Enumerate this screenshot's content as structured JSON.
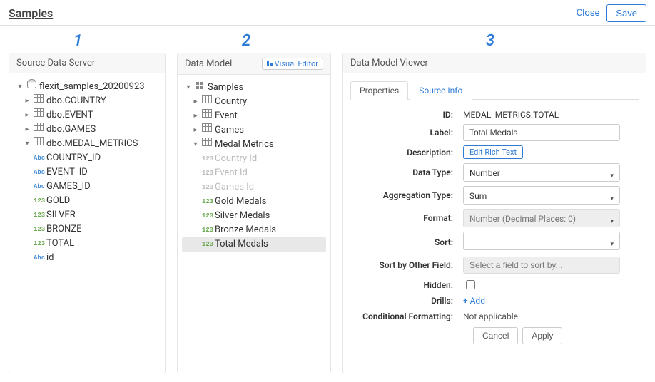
{
  "header": {
    "title": "Samples",
    "close": "Close",
    "save": "Save"
  },
  "badges": {
    "p1": "1",
    "p2": "2",
    "p3": "3"
  },
  "panel1": {
    "title": "Source Data Server",
    "root": "flexit_samples_20200923",
    "tables": [
      {
        "name": "dbo.COUNTRY",
        "expanded": false
      },
      {
        "name": "dbo.EVENT",
        "expanded": false
      },
      {
        "name": "dbo.GAMES",
        "expanded": false
      },
      {
        "name": "dbo.MEDAL_METRICS",
        "expanded": true,
        "columns": [
          {
            "name": "COUNTRY_ID",
            "type": "abc"
          },
          {
            "name": "EVENT_ID",
            "type": "abc"
          },
          {
            "name": "GAMES_ID",
            "type": "abc"
          },
          {
            "name": "GOLD",
            "type": "123"
          },
          {
            "name": "SILVER",
            "type": "123"
          },
          {
            "name": "BRONZE",
            "type": "123"
          },
          {
            "name": "TOTAL",
            "type": "123"
          },
          {
            "name": "id",
            "type": "abc"
          }
        ]
      }
    ]
  },
  "panel2": {
    "title": "Data Model",
    "visual_editor": "Visual Editor",
    "root": "Samples",
    "entities": [
      {
        "name": "Country",
        "expanded": false
      },
      {
        "name": "Event",
        "expanded": false
      },
      {
        "name": "Games",
        "expanded": false
      },
      {
        "name": "Medal Metrics",
        "expanded": true,
        "columns": [
          {
            "name": "Country Id",
            "type": "123",
            "grey": true
          },
          {
            "name": "Event Id",
            "type": "123",
            "grey": true
          },
          {
            "name": "Games Id",
            "type": "123",
            "grey": true
          },
          {
            "name": "Gold Medals",
            "type": "123"
          },
          {
            "name": "Silver Medals",
            "type": "123"
          },
          {
            "name": "Bronze Medals",
            "type": "123"
          },
          {
            "name": "Total Medals",
            "type": "123",
            "selected": true
          }
        ]
      }
    ]
  },
  "panel3": {
    "title": "Data Model Viewer",
    "tabs": {
      "properties": "Properties",
      "source": "Source Info"
    },
    "labels": {
      "id": "ID:",
      "label": "Label:",
      "description": "Description:",
      "datatype": "Data Type:",
      "aggtype": "Aggregation Type:",
      "format": "Format:",
      "sort": "Sort:",
      "sortby": "Sort by Other Field:",
      "hidden": "Hidden:",
      "drills": "Drills:",
      "condfmt": "Conditional Formatting:"
    },
    "values": {
      "id": "MEDAL_METRICS.TOTAL",
      "label": "Total Medals",
      "edit_rich": "Edit Rich Text",
      "datatype": "Number",
      "aggtype": "Sum",
      "format": "Number (Decimal Places: 0)",
      "sort": "",
      "sortby_placeholder": "Select a field to sort by...",
      "add": "Add",
      "na": "Not applicable",
      "cancel": "Cancel",
      "apply": "Apply"
    }
  }
}
